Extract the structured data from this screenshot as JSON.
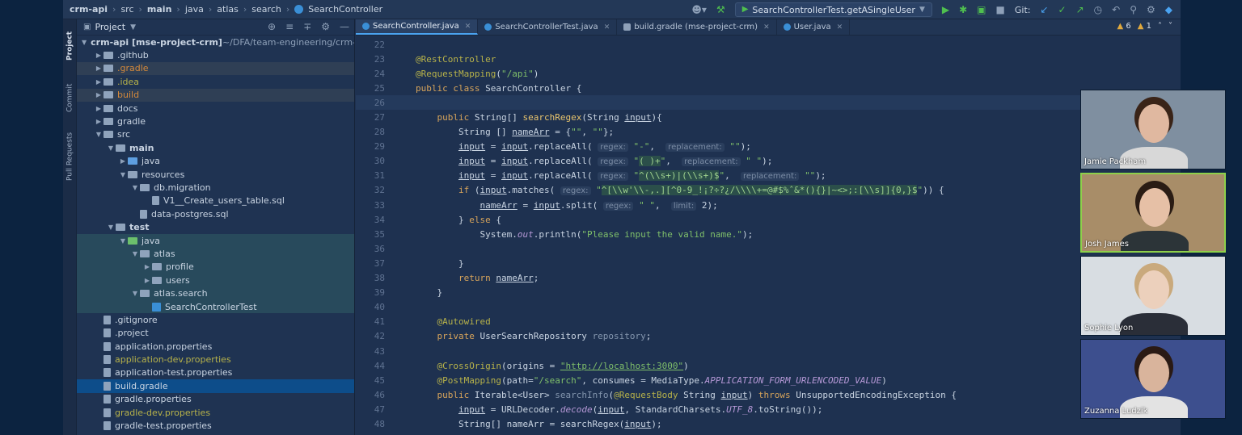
{
  "breadcrumbs": [
    {
      "label": "crm-api",
      "bold": true
    },
    {
      "label": "src",
      "bold": false
    },
    {
      "label": "main",
      "bold": true
    },
    {
      "label": "java",
      "bold": false
    },
    {
      "label": "atlas",
      "bold": false
    },
    {
      "label": "search",
      "bold": false
    },
    {
      "label": "SearchController",
      "bold": false
    }
  ],
  "toolbar": {
    "run_config": "SearchControllerTest.getASingleUser",
    "git_label": "Git:"
  },
  "tool_strip": {
    "project": "Project",
    "commit": "Commit",
    "pull_requests": "Pull Requests"
  },
  "project_panel": {
    "title": "Project",
    "tree": [
      {
        "indent": 0,
        "arrow": "v",
        "icon": "folder",
        "label": "crm-api [mse-project-crm]",
        "suffix": " ~/DFA/team-engineering/crm-a",
        "bold": true
      },
      {
        "indent": 1,
        "arrow": ">",
        "icon": "folder",
        "label": ".github"
      },
      {
        "indent": 1,
        "arrow": ">",
        "icon": "folder",
        "label": ".gradle",
        "style": "hl-orange"
      },
      {
        "indent": 1,
        "arrow": ">",
        "icon": "folder",
        "label": ".idea",
        "style": "yellow"
      },
      {
        "indent": 1,
        "arrow": ">",
        "icon": "folder",
        "label": "build",
        "style": "hl-orange"
      },
      {
        "indent": 1,
        "arrow": ">",
        "icon": "folder",
        "label": "docs"
      },
      {
        "indent": 1,
        "arrow": ">",
        "icon": "folder",
        "label": "gradle"
      },
      {
        "indent": 1,
        "arrow": "v",
        "icon": "folder",
        "label": "src"
      },
      {
        "indent": 2,
        "arrow": "v",
        "icon": "folder",
        "label": "main",
        "bold": true
      },
      {
        "indent": 3,
        "arrow": ">",
        "icon": "folder-blue",
        "label": "java"
      },
      {
        "indent": 3,
        "arrow": "v",
        "icon": "folder",
        "label": "resources"
      },
      {
        "indent": 4,
        "arrow": "v",
        "icon": "folder",
        "label": "db.migration"
      },
      {
        "indent": 5,
        "arrow": "",
        "icon": "file",
        "label": "V1__Create_users_table.sql"
      },
      {
        "indent": 4,
        "arrow": "",
        "icon": "file",
        "label": "data-postgres.sql"
      },
      {
        "indent": 2,
        "arrow": "v",
        "icon": "folder",
        "label": "test",
        "bold": true
      },
      {
        "indent": 3,
        "arrow": "v",
        "icon": "folder-green",
        "label": "java",
        "style": "hl-test"
      },
      {
        "indent": 4,
        "arrow": "v",
        "icon": "folder",
        "label": "atlas",
        "style": "hl-test"
      },
      {
        "indent": 5,
        "arrow": ">",
        "icon": "folder",
        "label": "profile",
        "style": "hl-test"
      },
      {
        "indent": 5,
        "arrow": ">",
        "icon": "folder",
        "label": "users",
        "style": "hl-test"
      },
      {
        "indent": 4,
        "arrow": "v",
        "icon": "folder",
        "label": "atlas.search",
        "style": "hl-test"
      },
      {
        "indent": 5,
        "arrow": "",
        "icon": "class",
        "label": "SearchControllerTest",
        "style": "hl-test"
      },
      {
        "indent": 1,
        "arrow": "",
        "icon": "file",
        "label": ".gitignore"
      },
      {
        "indent": 1,
        "arrow": "",
        "icon": "file",
        "label": ".project"
      },
      {
        "indent": 1,
        "arrow": "",
        "icon": "file",
        "label": "application.properties"
      },
      {
        "indent": 1,
        "arrow": "",
        "icon": "file",
        "label": "application-dev.properties",
        "style": "yellow"
      },
      {
        "indent": 1,
        "arrow": "",
        "icon": "file",
        "label": "application-test.properties"
      },
      {
        "indent": 1,
        "arrow": "",
        "icon": "file",
        "label": "build.gradle",
        "style": "sel"
      },
      {
        "indent": 1,
        "arrow": "",
        "icon": "file",
        "label": "gradle.properties"
      },
      {
        "indent": 1,
        "arrow": "",
        "icon": "file",
        "label": "gradle-dev.properties",
        "style": "yellow"
      },
      {
        "indent": 1,
        "arrow": "",
        "icon": "file",
        "label": "gradle-test.properties"
      }
    ]
  },
  "editor_tabs": [
    {
      "label": "SearchController.java",
      "active": true,
      "icon": "class"
    },
    {
      "label": "SearchControllerTest.java",
      "active": false,
      "icon": "class"
    },
    {
      "label": "build.gradle (mse-project-crm)",
      "active": false,
      "icon": "gradle"
    },
    {
      "label": "User.java",
      "active": false,
      "icon": "class"
    }
  ],
  "inspections": {
    "warnings": "6",
    "weak_warnings": "1"
  },
  "code_lines": [
    {
      "n": "22",
      "html": ""
    },
    {
      "n": "23",
      "html": "<span class='ann'>@RestController</span>"
    },
    {
      "n": "24",
      "html": "<span class='ann'>@RequestMapping</span>(<span class='str'>\"/api\"</span>)"
    },
    {
      "n": "25",
      "html": "<span class='kw'>public class</span> SearchController {"
    },
    {
      "n": "26",
      "html": "",
      "current": true
    },
    {
      "n": "27",
      "html": "    <span class='kw'>public</span> String[] <span class='fn'>searchRegex</span>(String <span class='ul'>input</span>){"
    },
    {
      "n": "28",
      "html": "        String [] <span class='ul'>nameArr</span> = {<span class='str'>\"\"</span>, <span class='str'>\"\"</span>};"
    },
    {
      "n": "29",
      "html": "        <span class='ul'>input</span> = <span class='ul'>input</span>.replaceAll( <span class='hint'>regex:</span> <span class='str'>\"-\"</span>,  <span class='hint'>replacement:</span> <span class='str'>\"\"</span>);"
    },
    {
      "n": "30",
      "html": "        <span class='ul'>input</span> = <span class='ul'>input</span>.replaceAll( <span class='hint'>regex:</span> <span class='str'>\"<span class='regex'>( )+</span>\"</span>,  <span class='hint'>replacement:</span> <span class='str'>\" \"</span>);"
    },
    {
      "n": "31",
      "html": "        <span class='ul'>input</span> = <span class='ul'>input</span>.replaceAll( <span class='hint'>regex:</span> <span class='str'>\"<span class='regex'>^(\\\\s+)|(\\\\s+)$</span>\"</span>,  <span class='hint'>replacement:</span> <span class='str'>\"\"</span>);"
    },
    {
      "n": "32",
      "html": "        <span class='kw'>if</span> (<span class='ul'>input</span>.matches( <span class='hint'>regex:</span> <span class='str'>\"<span class='regex'>^[\\\\w'\\\\-,.][^0-9_!¡?÷?¿/\\\\\\\\+=@#$%ˆ&*(){}|~<>;:[\\\\s]]{0,}$</span>\"</span>)) {"
    },
    {
      "n": "33",
      "html": "            <span class='ul'>nameArr</span> = <span class='ul'>input</span>.split( <span class='hint'>regex:</span> <span class='str'>\" \"</span>,  <span class='hint'>limit:</span> 2);"
    },
    {
      "n": "34",
      "html": "        } <span class='kw'>else</span> {"
    },
    {
      "n": "35",
      "html": "            System.<span class='ital'>out</span>.println(<span class='str'>\"Please input the valid name.\"</span>);"
    },
    {
      "n": "36",
      "html": ""
    },
    {
      "n": "37",
      "html": "        }"
    },
    {
      "n": "38",
      "html": "        <span class='kw'>return</span> <span class='ul'>nameArr</span>;"
    },
    {
      "n": "39",
      "html": "    }"
    },
    {
      "n": "40",
      "html": ""
    },
    {
      "n": "41",
      "html": "    <span class='ann'>@Autowired</span>"
    },
    {
      "n": "42",
      "html": "    <span class='kw'>private</span> UserSearchRepository <span class='grey2'>repository</span>;"
    },
    {
      "n": "43",
      "html": ""
    },
    {
      "n": "44",
      "html": "    <span class='ann'>@CrossOrigin</span>(origins = <span class='str ul'>\"http://localhost:3000\"</span>)"
    },
    {
      "n": "45",
      "html": "    <span class='ann'>@PostMapping</span>(path=<span class='str'>\"/search\"</span>, consumes = MediaType.<span class='ital'>APPLICATION_FORM_URLENCODED_VALUE</span>)"
    },
    {
      "n": "46",
      "html": "    <span class='kw'>public</span> Iterable&lt;User&gt; <span class='grey2'>searchInfo</span>(<span class='ann'>@RequestBody</span> String <span class='ul'>input</span>) <span class='kw'>throws</span> UnsupportedEncodingException {"
    },
    {
      "n": "47",
      "html": "        <span class='ul'>input</span> = URLDecoder.<span class='ital'>decode</span>(<span class='ul'>input</span>, StandardCharsets.<span class='ital'>UTF_8</span>.toString());"
    },
    {
      "n": "48",
      "html": "        String[] nameArr = searchRegex(<span class='ul'>input</span>);"
    }
  ],
  "participants": [
    {
      "name": "Jamie Packham",
      "active": false,
      "bg": "#7f8fa0",
      "skin": "#e0b8a0",
      "shirt": "#d8d8d8",
      "hair": "#3a2418"
    },
    {
      "name": "Josh James",
      "active": true,
      "bg": "#a88d68",
      "skin": "#e6c0a6",
      "shirt": "#2c3438",
      "hair": "#2a1c14"
    },
    {
      "name": "Sophie Lyon",
      "active": false,
      "bg": "#d8dde2",
      "skin": "#ecd0bc",
      "shirt": "#2a2e38",
      "hair": "#c9a97c"
    },
    {
      "name": "Zuzanna Ludzik",
      "active": false,
      "bg": "#3d4f8e",
      "skin": "#d9b49c",
      "shirt": "#e3e3e3",
      "hair": "#2a1a14"
    }
  ]
}
